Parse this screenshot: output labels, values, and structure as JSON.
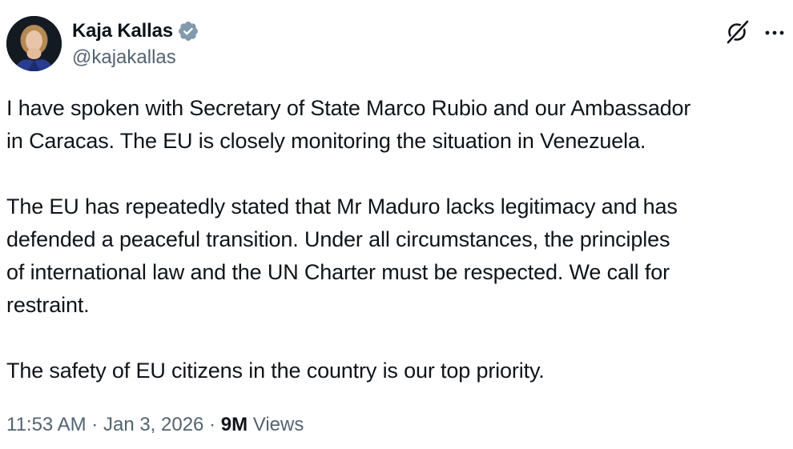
{
  "author": {
    "display_name": "Kaja Kallas",
    "handle": "@kajakallas",
    "verified_badge_icon": "verified-badge-icon",
    "badge_color": "#829aab"
  },
  "actions": {
    "grok_icon": "grok-icon",
    "more_icon": "more-options-icon"
  },
  "post": {
    "paragraphs": [
      "I have spoken with Secretary of State Marco Rubio and our Ambassador\nin Caracas. The EU is closely monitoring the situation in Venezuela.",
      "The EU has repeatedly stated that Mr Maduro lacks legitimacy and has\ndefended a peaceful transition. Under all circumstances, the principles\nof international law and the UN Charter must be respected. We call for\nrestraint.",
      "The safety of EU citizens in the country is our top priority."
    ]
  },
  "meta": {
    "time": "11:53 AM",
    "separator": "·",
    "date": "Jan 3, 2026",
    "views_count": "9M",
    "views_label": "Views"
  },
  "colors": {
    "text_primary": "#0f1419",
    "text_secondary": "#536471",
    "background": "#ffffff"
  }
}
